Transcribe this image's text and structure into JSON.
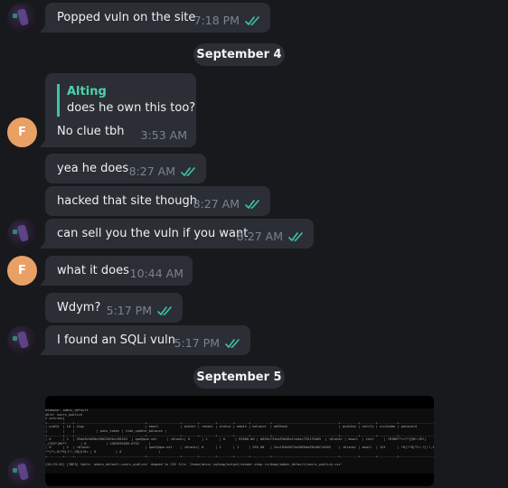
{
  "theme": {
    "accent": "#4fd1ac",
    "bubble_bg": "#2b2f35",
    "background": "#17191d",
    "avatar_f_color": "#e8a065"
  },
  "messages": [
    {
      "id": "m1",
      "sender": "avatar-image",
      "text": "Popped vuln on the site",
      "time": "7:18 PM",
      "read": true,
      "icon": "double-check-icon"
    },
    {
      "id": "m2",
      "sender": "F",
      "reply_to": {
        "name": "Alting",
        "text": "does he own this too?"
      },
      "text": "No clue tbh",
      "time": "3:53 AM"
    },
    {
      "id": "m3",
      "sender": "avatar-image",
      "text": "yea he does",
      "time": "8:27 AM",
      "read": true
    },
    {
      "id": "m4",
      "sender": "avatar-image",
      "text": "hacked that site though",
      "time": "8:27 AM",
      "read": true
    },
    {
      "id": "m5",
      "sender": "avatar-image",
      "text": "can sell you the vuln if you want",
      "time": "8:27 AM",
      "read": true
    },
    {
      "id": "m6",
      "sender": "F",
      "text": "what it does",
      "time": "10:44 AM"
    },
    {
      "id": "m7",
      "sender": "avatar-image",
      "text": "Wdym?",
      "time": "5:17 PM",
      "read": true
    },
    {
      "id": "m8",
      "sender": "avatar-image",
      "text": "I found an SQLi vuln",
      "time": "5:17 PM",
      "read": true
    },
    {
      "id": "m9",
      "sender": "avatar-image",
      "type": "image",
      "alt": "terminal screenshot of sqlmap table dump"
    }
  ],
  "dates": [
    "September 4",
    "September 5"
  ],
  "avatar_f_initial": "F",
  "screenshot": {
    "lines": [
      "atabase: admin_default",
      "able: users_publick",
      "2 entries]",
      "+--------+----+------------------------------------+-----------------+--------+--------+--------+-------+----------+----------------------------------+---------+--------+----------+----------------------+",
      "| pubId  | id | sign                               | email           | avatar | remail | status | admin | balance  | md5hash                          | pushkey | notify | nickname | password             |",
      "|        |    |           | pass_token | time_update_balance |",
      "+--------+----+------------------------------------+-----------------+--------+--------+--------+-------+----------+----------------------------------+---------+--------+----------+----------------------+",
      "| 0      | 1  | 35de9d4d90e30023d9b1c98163  | qwe@qwe.net     | <blank>| 0      | 1      | 0     | 62000.00 | b650cf31ae93b38e11e0ac7551f3b65  | <blank> | email  | test     | !MJ8B7*<<?*[@8!=1R!|",
      ",[?@3*]00**       | 0          | 1563592089.8792     |",
      "| 0      | 2  | <blank>                            | qwe2@qwe.net    | <blank>| 0      | 1      | 1     | 555.00   | 2ecf84a9875a2080da356d0f14505    | <blank> | email  | 123      | *8[!*8[*C<,*[!!,1<*  |",
      "!*[*<,8(*R[J!!,38[@!8< | 0          | 0                   |",
      "+--------+----+------------------------------------+-----------------+--------+--------+--------+-------+----------+----------------------------------+---------+--------+----------+----------------------+",
      "",
      "[20:33:45] [INFO] table 'admin_default.users_publick' dumped to CSV file '/home/anon/.sqlmap/output/vendor-shop.ru/dump/admin_default/users_publick.csv'"
    ]
  }
}
